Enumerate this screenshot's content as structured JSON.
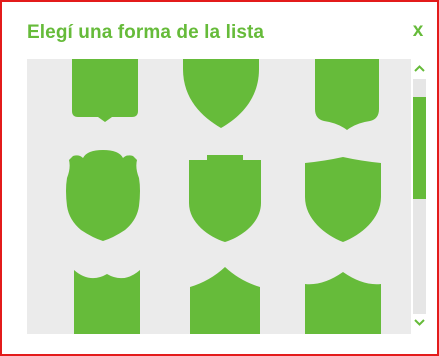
{
  "dialog": {
    "title": "Elegí una forma de la lista",
    "close_label": "x"
  },
  "colors": {
    "accent": "#66bb3a",
    "list_background": "#ebebeb",
    "border": "#e31b1b"
  },
  "shapes": [
    {
      "name": "shield-shape-notched-square"
    },
    {
      "name": "shield-shape-classic-pointed"
    },
    {
      "name": "shield-shape-rounded-notch"
    },
    {
      "name": "shield-shape-ornate-crest"
    },
    {
      "name": "shield-shape-flat-notched"
    },
    {
      "name": "shield-shape-curved-top"
    },
    {
      "name": "shield-shape-scalloped"
    },
    {
      "name": "shield-shape-arched"
    },
    {
      "name": "shield-shape-wavy-top"
    }
  ],
  "scrollbar": {
    "up_icon": "chevron-up-icon",
    "down_icon": "chevron-down-icon"
  }
}
